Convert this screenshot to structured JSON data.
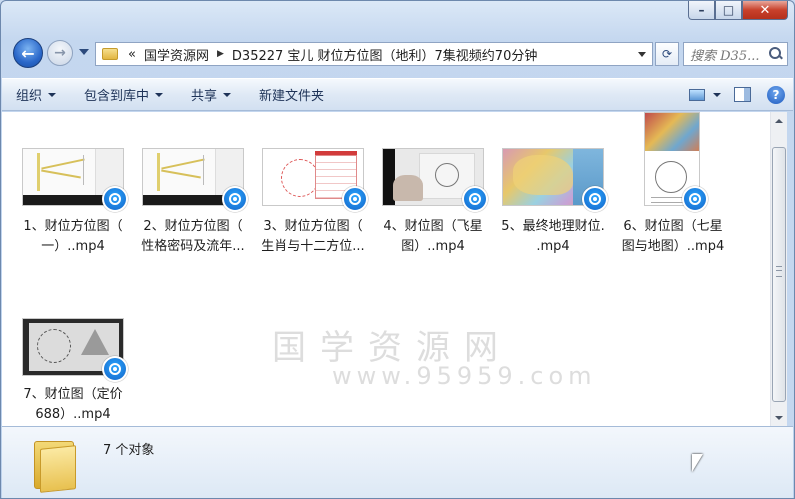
{
  "nav": {
    "breadcrumbs": [
      "«",
      "国学资源网",
      "D35227 宝儿 财位方位图（地利）7集视频约70分钟"
    ]
  },
  "search": {
    "placeholder": "搜索 D35..."
  },
  "toolbar": {
    "organize": "组织",
    "include_library": "包含到库中",
    "share": "共享",
    "new_folder": "新建文件夹"
  },
  "files": [
    {
      "line1": "1、财位方位图（",
      "line2": "一）..mp4"
    },
    {
      "line1": "2、财位方位图（",
      "line2": "性格密码及流年..."
    },
    {
      "line1": "3、财位方位图（",
      "line2": "生肖与十二方位..."
    },
    {
      "line1": "4、财位图（飞星",
      "line2": "图）..mp4"
    },
    {
      "line1": "5、最终地理财位.",
      "line2": ".mp4"
    },
    {
      "line1": "6、财位图（七星",
      "line2": "图与地图）..mp4"
    },
    {
      "line1": "7、财位图（定价",
      "line2": "688）..mp4"
    }
  ],
  "watermark": {
    "text": "国学资源网",
    "url": "www.95959.com"
  },
  "details": {
    "count": "7 个对象"
  },
  "colors": {
    "accent": "#1363c6",
    "frame": "#c4d7ef",
    "toolbar_text": "#1e3358"
  },
  "icons": {
    "back": "arrow-left-icon",
    "forward": "arrow-right-icon",
    "refresh": "refresh-icon",
    "search": "search-icon",
    "help": "help-icon",
    "badge": "video-player-icon"
  }
}
